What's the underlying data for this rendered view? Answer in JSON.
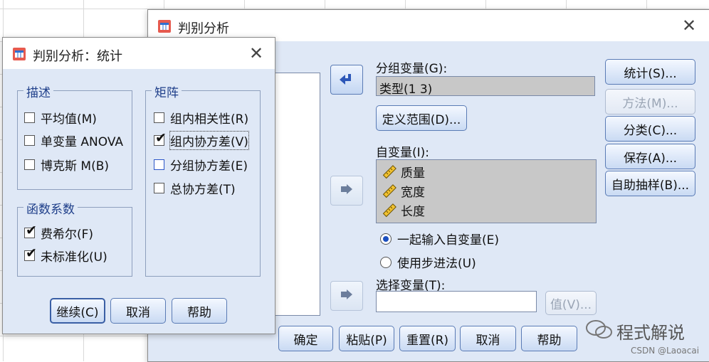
{
  "main": {
    "title": "判别分析",
    "grouping_label": "分组变量(G):",
    "grouping_value": "类型(1 3)",
    "define_range": "定义范围(D)...",
    "independent_label": "自变量(I):",
    "variables": [
      "质量",
      "宽度",
      "长度"
    ],
    "radio_enter_together": "一起输入自变量(E)",
    "radio_stepwise": "使用步进法(U)",
    "selection_label": "选择变量(T):",
    "value_button": "值(V)...",
    "side_buttons": {
      "statistics": "统计(S)...",
      "method": "方法(M)...",
      "classify": "分类(C)...",
      "save": "保存(A)...",
      "bootstrap": "自助抽样(B)..."
    },
    "bottom_buttons": {
      "ok": "确定",
      "paste": "粘贴(P)",
      "reset": "重置(R)",
      "cancel": "取消",
      "help": "帮助"
    }
  },
  "stats": {
    "title": "判别分析：统计",
    "describe_legend": "描述",
    "mean": "平均值(M)",
    "univariate_anova": "单变量 ANOVA",
    "box_m": "博克斯 M(B)",
    "coef_legend": "函数系数",
    "fisher": "费希尔(F)",
    "unstandardized": "未标准化(U)",
    "matrix_legend": "矩阵",
    "within_corr": "组内相关性(R)",
    "within_cov": "组内协方差(V)",
    "separate_cov": "分组协方差(E)",
    "total_cov": "总协方差(T)",
    "continue": "继续(C)",
    "cancel": "取消",
    "help": "帮助",
    "checked": {
      "mean": false,
      "univariate_anova": false,
      "box_m": false,
      "fisher": true,
      "unstandardized": true,
      "within_corr": false,
      "within_cov": true,
      "separate_cov": false,
      "total_cov": false
    }
  },
  "watermark": {
    "brand": "程式解说",
    "source": "CSDN @Laoacai"
  },
  "colors": {
    "dialog_bg": "#dfe8f6",
    "titlebar": "#ffffff",
    "button_border": "#5a7bb5",
    "legend_text": "#1f3f8a"
  },
  "icons": {
    "app": "spss-dialog-icon",
    "arrow": "arrow-right-icon",
    "variable": "ruler-scale-icon"
  }
}
